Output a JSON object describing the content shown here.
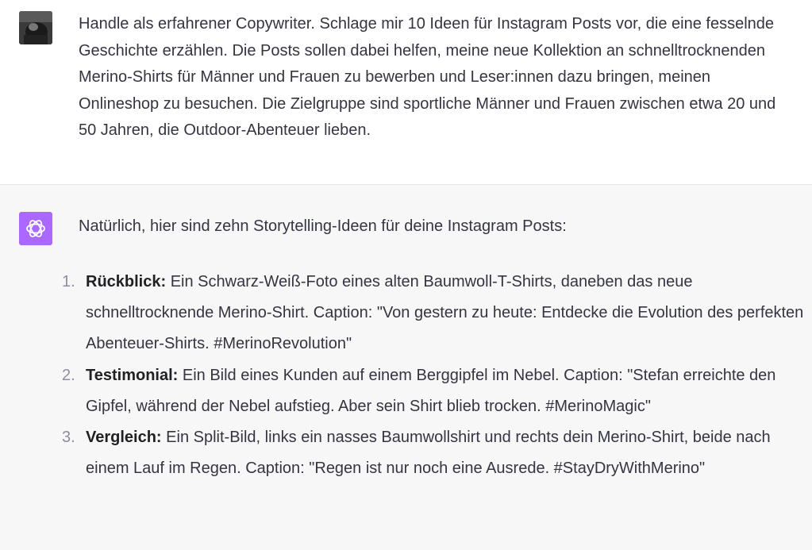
{
  "user_message": {
    "text": "Handle als erfahrener Copywriter. Schlage mir 10 Ideen für Instagram Posts vor, die eine fesselnde Geschichte erzählen. Die Posts sollen dabei helfen, meine neue Kollektion an schnelltrocknenden Merino-Shirts für Männer und Frauen zu bewerben und Leser:innen dazu bringen, meinen Onlineshop zu besuchen. Die Zielgruppe sind sportliche Männer und Frauen zwischen etwa 20 und 50 Jahren, die Outdoor-Abenteuer lieben."
  },
  "assistant_message": {
    "intro": "Natürlich, hier sind zehn Storytelling-Ideen für deine Instagram Posts:",
    "items": [
      {
        "number": "1.",
        "title": "Rückblick:",
        "body": " Ein Schwarz-Weiß-Foto eines alten Baumwoll-T-Shirts, daneben das neue schnelltrocknende Merino-Shirt. Caption: \"Von gestern zu heute: Entdecke die Evolution des perfekten Abenteuer-Shirts. #MerinoRevolution\""
      },
      {
        "number": "2.",
        "title": "Testimonial:",
        "body": " Ein Bild eines Kunden auf einem Berggipfel im Nebel. Caption: \"Stefan erreichte den Gipfel, während der Nebel aufstieg. Aber sein Shirt blieb trocken. #MerinoMagic\""
      },
      {
        "number": "3.",
        "title": "Vergleich:",
        "body": " Ein Split-Bild, links ein nasses Baumwollshirt und rechts dein Merino-Shirt, beide nach einem Lauf im Regen. Caption: \"Regen ist nur noch eine Ausrede. #StayDryWithMerino\""
      }
    ]
  },
  "colors": {
    "assistant_avatar_bg": "#ab68ff",
    "assistant_bg": "#f7f7f8",
    "text": "#343541"
  },
  "icons": {
    "user_avatar": "user-avatar-photo",
    "assistant_avatar": "openai-logo-icon"
  }
}
